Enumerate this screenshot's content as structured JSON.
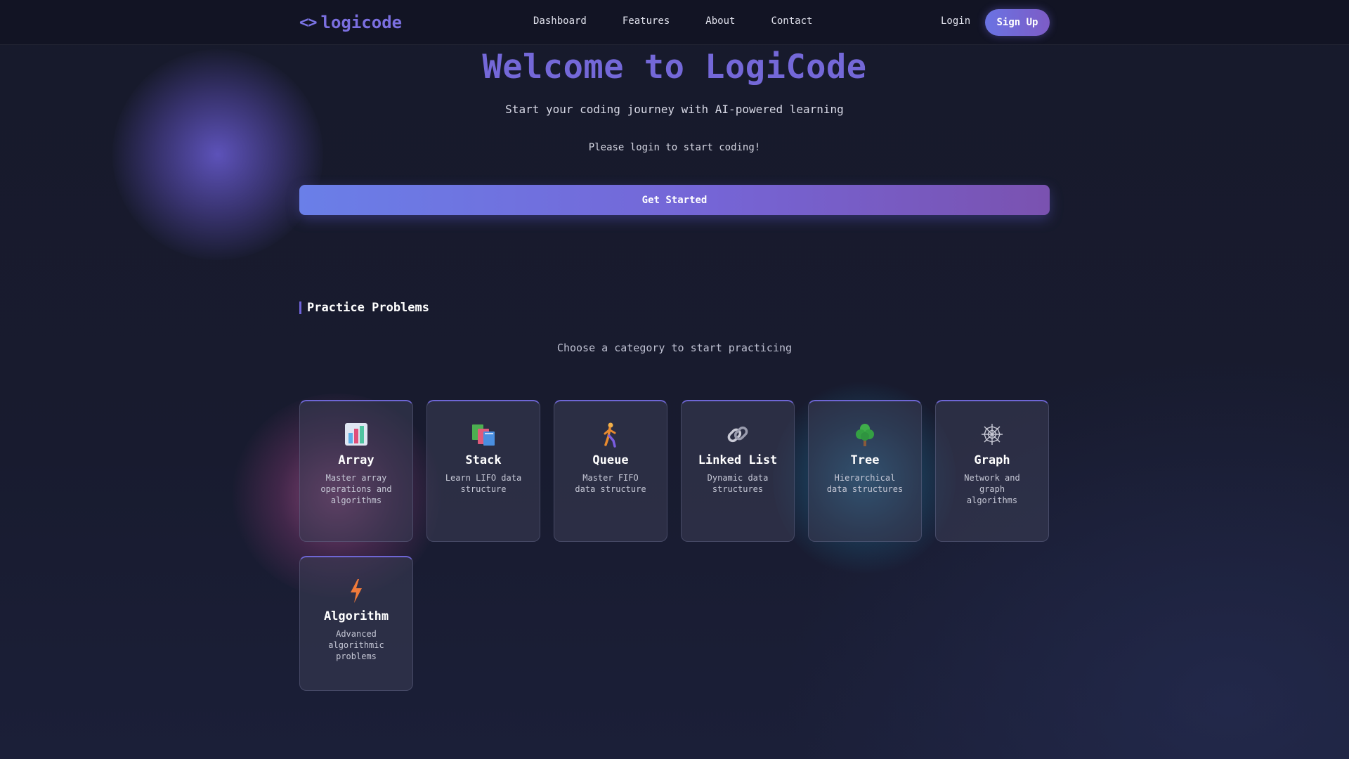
{
  "nav": {
    "logo_icon": "<>",
    "logo_text": "logicode",
    "links": [
      "Dashboard",
      "Features",
      "About",
      "Contact"
    ],
    "login": "Login",
    "signup": "Sign Up"
  },
  "hero": {
    "title": "Welcome to LogiCode",
    "subtitle": "Start your coding journey with AI-powered learning",
    "login_prompt": "Please login to start coding!",
    "cta": "Get Started"
  },
  "practice": {
    "title": "Practice Problems",
    "subtitle": "Choose a category to start practicing",
    "categories": [
      {
        "title": "Array",
        "desc": "Master array operations and algorithms",
        "icon": "bar-chart-icon"
      },
      {
        "title": "Stack",
        "desc": "Learn LIFO data structure",
        "icon": "books-stack-icon"
      },
      {
        "title": "Queue",
        "desc": "Master FIFO data structure",
        "icon": "walking-person-icon"
      },
      {
        "title": "Linked List",
        "desc": "Dynamic data structures",
        "icon": "chain-link-icon"
      },
      {
        "title": "Tree",
        "desc": "Hierarchical data structures",
        "icon": "tree-icon"
      },
      {
        "title": "Graph",
        "desc": "Network and graph algorithms",
        "icon": "spider-web-icon"
      },
      {
        "title": "Algorithm",
        "desc": "Advanced algorithmic problems",
        "icon": "lightning-icon"
      }
    ]
  },
  "colors": {
    "accent": "#7468d8",
    "background": "#171a2e",
    "card_border_top": "#6e66d4"
  }
}
